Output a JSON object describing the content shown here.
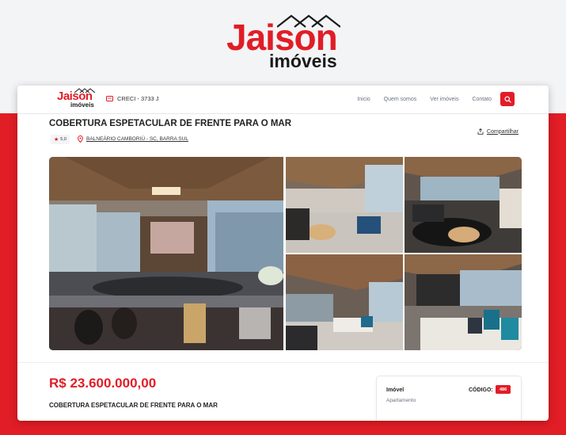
{
  "brand": {
    "name_primary": "Jaison",
    "name_secondary": "imóveis",
    "primary_color": "#e11d26",
    "dark_color": "#1a1a1a"
  },
  "nav": {
    "creci": "CRECI - 3733 J",
    "links": [
      "Inicio",
      "Quem somos",
      "Ver imóveis",
      "Contato"
    ],
    "search_icon": "search-icon"
  },
  "listing": {
    "title": "COBERTURA ESPETACULAR DE FRENTE PARA O MAR",
    "rating": "5,0",
    "location": "BALNEÁRIO CAMBORIÚ - SC, BARRA SUL",
    "share_label": "Compartilhar",
    "price": "R$ 23.600.000,00",
    "subtitle": "COBERTURA ESPETACULAR DE FRENTE PARA O MAR"
  },
  "info_box": {
    "type_label": "Imóvel",
    "type_value": "Apartamento",
    "code_label": "CÓDIGO:",
    "code_value": "486"
  }
}
